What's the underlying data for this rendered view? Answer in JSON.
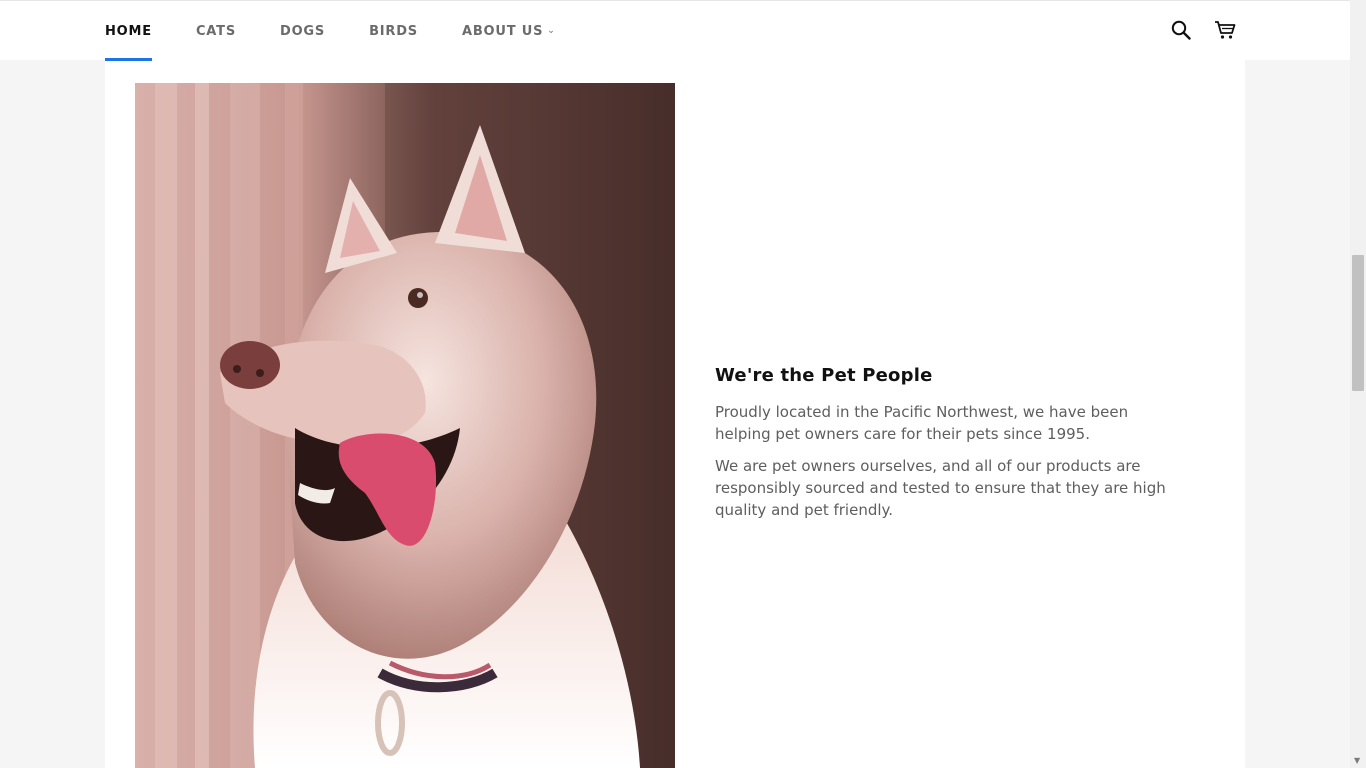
{
  "nav": {
    "items": [
      {
        "label": "HOME",
        "active": true
      },
      {
        "label": "CATS",
        "active": false
      },
      {
        "label": "DOGS",
        "active": false
      },
      {
        "label": "BIRDS",
        "active": false
      },
      {
        "label": "ABOUT US",
        "active": false
      }
    ],
    "about_chevron": "⌄"
  },
  "header_icons": [
    "search-icon",
    "cart-icon"
  ],
  "colors": {
    "accent": "#1b75e6",
    "text_dark": "#111111",
    "text_body": "#5e5e5e",
    "page_bg": "#f5f5f5"
  },
  "feature": {
    "title": "We're the Pet People",
    "paragraphs": [
      "Proudly located in the Pacific Northwest, we have been helping pet owners care for their pets since 1995.",
      "We are pet owners ourselves, and all of our products are responsibly sourced and tested to ensure that they are high quality and pet friendly."
    ]
  }
}
